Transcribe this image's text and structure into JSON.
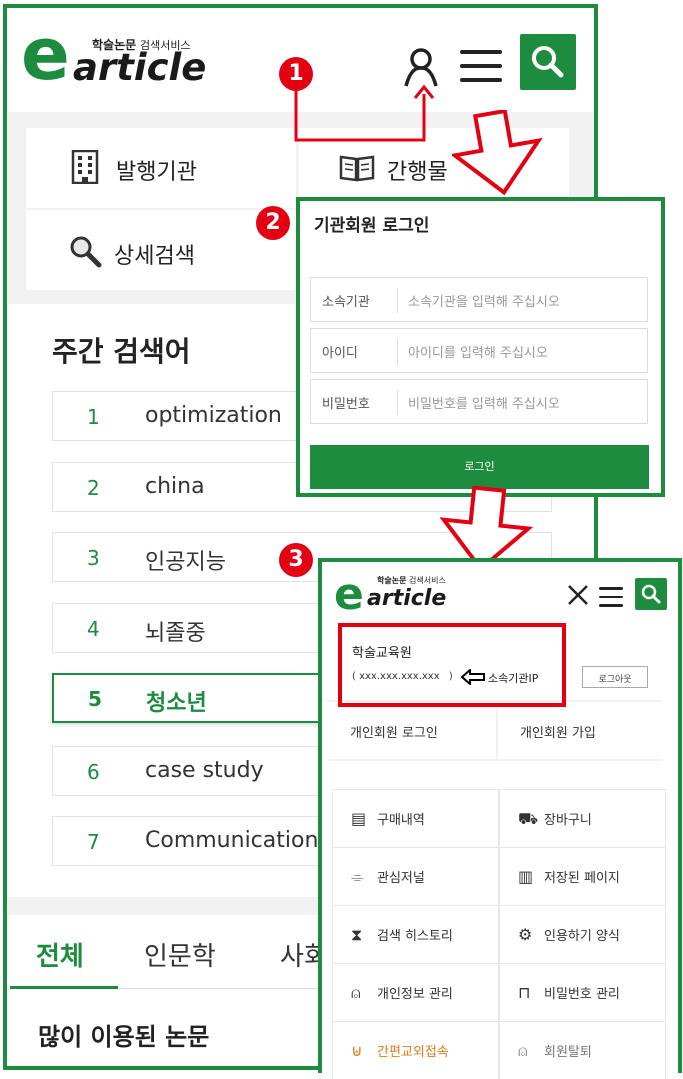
{
  "brand": {
    "logo_e": "e",
    "logo_text": "article",
    "tagline_bold": "학술논문",
    "tagline_rest": "검색서비스"
  },
  "steps": [
    "1",
    "2",
    "3"
  ],
  "quick_links": {
    "publisher": "발행기관",
    "publication": "간행물",
    "advanced_search": "상세검색"
  },
  "weekly": {
    "title": "주간 검색어",
    "items": [
      {
        "rank": "1",
        "keyword": "optimization"
      },
      {
        "rank": "2",
        "keyword": "china"
      },
      {
        "rank": "3",
        "keyword": "인공지능"
      },
      {
        "rank": "4",
        "keyword": "뇌졸중"
      },
      {
        "rank": "5",
        "keyword": "청소년"
      },
      {
        "rank": "6",
        "keyword": "case study"
      },
      {
        "rank": "7",
        "keyword": "Communication"
      }
    ]
  },
  "category_tabs": [
    "전체",
    "인문학",
    "사회"
  ],
  "popular_title": "많이 이용된 논문",
  "login_panel": {
    "title": "기관회원 로그인",
    "fields": [
      {
        "label": "소속기관",
        "placeholder": "소속기관을 입력해 주십시오"
      },
      {
        "label": "아이디",
        "placeholder": "아이디를 입력해 주십시오"
      },
      {
        "label": "비밀번호",
        "placeholder": "비밀번호를 입력해 주십시오"
      }
    ],
    "submit_label": "로그인"
  },
  "result_panel": {
    "institution": "학술교육원",
    "ip_open": "(",
    "ip": "xxx.xxx.xxx.xxx",
    "ip_close": ")",
    "ip_note": "소속기관IP",
    "logout_label": "로그아웃",
    "personal_login": "개인회원 로그인",
    "personal_join": "개인회원 가입",
    "menu": [
      {
        "icon": "document-icon",
        "label": "구매내역"
      },
      {
        "icon": "cart-icon",
        "label": "장바구니"
      },
      {
        "icon": "bookmark-icon",
        "label": "관심저널"
      },
      {
        "icon": "book-icon",
        "label": "저장된 페이지"
      },
      {
        "icon": "hourglass-icon",
        "label": "검색 히스토리"
      },
      {
        "icon": "gears-icon",
        "label": "인용하기 양식"
      },
      {
        "icon": "user-icon",
        "label": "개인정보 관리"
      },
      {
        "icon": "lock-icon",
        "label": "비밀번호 관리"
      },
      {
        "icon": "mouse-icon",
        "label": "간편교외접속"
      },
      {
        "icon": "user-settings-icon",
        "label": "회원탈퇴"
      }
    ]
  },
  "colors": {
    "brand_green": "#1e8c3f",
    "annotation_red": "#e30012",
    "highlight_orange": "#e37a1f"
  }
}
